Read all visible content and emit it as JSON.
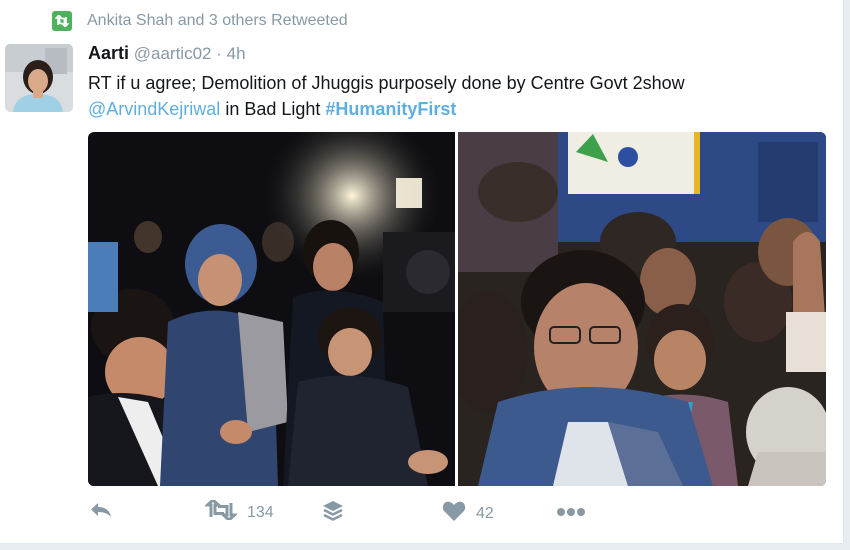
{
  "retweet_context": {
    "icon": "retweet-badge-icon",
    "text": "Ankita Shah and 3 others Retweeted"
  },
  "tweet": {
    "author_name": "Aarti",
    "handle": "@aartic02",
    "separator": "·",
    "time": "4h",
    "text_part1": "RT if u agree; Demolition of Jhuggis purposely done by Centre Govt 2show",
    "mention": "@ArvindKejriwal",
    "text_part2": " in Bad Light ",
    "hashtag": "#HumanityFirst"
  },
  "actions": {
    "reply_icon": "reply-icon",
    "retweet_icon": "retweet-icon",
    "retweet_count": "134",
    "buffer_icon": "layers-icon",
    "like_icon": "heart-icon",
    "like_count": "42",
    "more_icon": "more-dots-icon"
  },
  "colors": {
    "link": "#5faee0",
    "muted": "#8899a6",
    "retweet_badge": "#4fb05e"
  }
}
